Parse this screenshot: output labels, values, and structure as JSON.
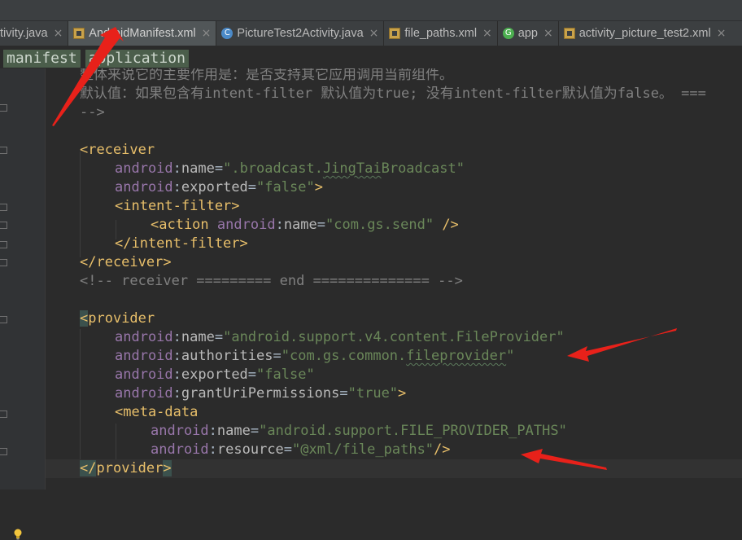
{
  "tabs": [
    {
      "label": "tivity.java",
      "icon": "class-icon",
      "active": false
    },
    {
      "label": "AndroidManifest.xml",
      "icon": "xml-file-icon",
      "active": true
    },
    {
      "label": "PictureTest2Activity.java",
      "icon": "class-icon",
      "active": false
    },
    {
      "label": "file_paths.xml",
      "icon": "xml-file-icon",
      "active": false
    },
    {
      "label": "app",
      "icon": "gradle-module-icon",
      "active": false
    },
    {
      "label": "activity_picture_test2.xml",
      "icon": "xml-file-icon",
      "active": false
    }
  ],
  "close_glyph": "×",
  "breadcrumb": [
    "manifest",
    "application"
  ],
  "code": {
    "l1": "整体来说它的主要作用是：是否支持其它应用调用当前组件。",
    "l2": "默认值：如果包含有intent-filter 默认值为true; 没有intent-filter默认值为false。 ===",
    "l3": "-->",
    "receiver_open": "<receiver",
    "ns": "android",
    "colon": ":",
    "attr_name": "name",
    "attr_exported": "exported",
    "attr_authorities": "authorities",
    "attr_grant": "grantUriPermissions",
    "attr_resource": "resource",
    "eq": "=",
    "r_name_val_pre": "\".broadcast.",
    "r_name_val_wavy": "JingTai",
    "r_name_val_post": "Broadcast\"",
    "false_val": "\"false\"",
    "true_val": "\"true\"",
    "gt": ">",
    "intent_open": "<intent-filter>",
    "action_open": "<action",
    "action_val": "\"com.gs.send\"",
    "self_close": " />",
    "intent_close": "</intent-filter>",
    "receiver_close": "</receiver>",
    "receiver_cmt": "<!-- receiver ========= end ============== -->",
    "provider_lt": "<",
    "provider_tag": "provider",
    "p_name_val": "\"android.support.v4.content.FileProvider\"",
    "p_auth_pre": "\"com.gs.common.",
    "p_auth_wavy": "fileprovider",
    "p_auth_post": "\"",
    "meta_open": "<meta-data",
    "meta_name_val": "\"android.support.FILE_PROVIDER_PATHS\"",
    "meta_res_val": "\"@xml/file_paths\"",
    "meta_close": "/>",
    "provider_close_pre": "</",
    "provider_close_tag": "provider",
    "provider_close_post": ">"
  },
  "colors": {
    "background": "#2b2b2b",
    "tag": "#e8bf6a",
    "namespace": "#9876aa",
    "string": "#6a8759",
    "comment": "#808080",
    "annotation_arrow": "#e8211a"
  }
}
